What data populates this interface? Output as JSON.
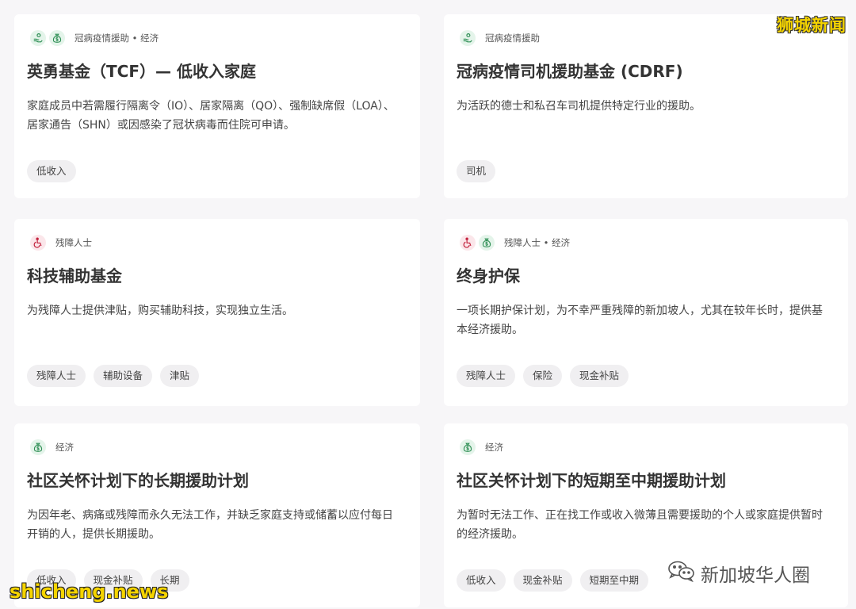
{
  "cards": [
    {
      "category": "冠病疫情援助 • 经济",
      "icons": [
        "relief-hand-icon",
        "money-bag-icon"
      ],
      "title": "英勇基金（TCF）— 低收入家庭",
      "description": "家庭成员中若需履行隔离令（IO）、居家隔离（QO）、强制缺席假（LOA）、居家通告（SHN）或因感染了冠状病毒而住院可申请。",
      "tags": [
        "低收入"
      ]
    },
    {
      "category": "冠病疫情援助",
      "icons": [
        "relief-hand-icon"
      ],
      "title": "冠病疫情司机援助基金 (CDRF)",
      "description": "为活跃的德士和私召车司机提供特定行业的援助。",
      "tags": [
        "司机"
      ]
    },
    {
      "category": "残障人士",
      "icons": [
        "wheelchair-icon"
      ],
      "title": "科技辅助基金",
      "description": "为残障人士提供津贴，购买辅助科技，实现独立生活。",
      "tags": [
        "残障人士",
        "辅助设备",
        "津贴"
      ]
    },
    {
      "category": "残障人士 • 经济",
      "icons": [
        "wheelchair-icon",
        "money-bag-icon"
      ],
      "title": "终身护保",
      "description": "一项长期护保计划，为不幸严重残障的新加坡人，尤其在较年长时，提供基本经济援助。",
      "tags": [
        "残障人士",
        "保险",
        "现金补贴"
      ]
    },
    {
      "category": "经济",
      "icons": [
        "money-bag-icon"
      ],
      "title": "社区关怀计划下的长期援助计划",
      "description": "为因年老、病痛或残障而永久无法工作，并缺乏家庭支持或储蓄以应付每日开销的人，提供长期援助。",
      "tags": [
        "低收入",
        "现金补贴",
        "长期"
      ]
    },
    {
      "category": "经济",
      "icons": [
        "money-bag-icon"
      ],
      "title": "社区关怀计划下的短期至中期援助计划",
      "description": "为暂时无法工作、正在找工作或收入微薄且需要援助的个人或家庭提供暂时的经济援助。",
      "tags": [
        "低收入",
        "现金补贴",
        "短期至中期"
      ]
    }
  ],
  "watermarks": {
    "top_right": "狮城新闻",
    "bottom_left": "shicheng.news",
    "bottom_right": "新加坡华人圈"
  },
  "colors": {
    "green_icon": "#2f8f55",
    "red_icon": "#c3243f",
    "watermark_yellow": "#f5d400"
  }
}
